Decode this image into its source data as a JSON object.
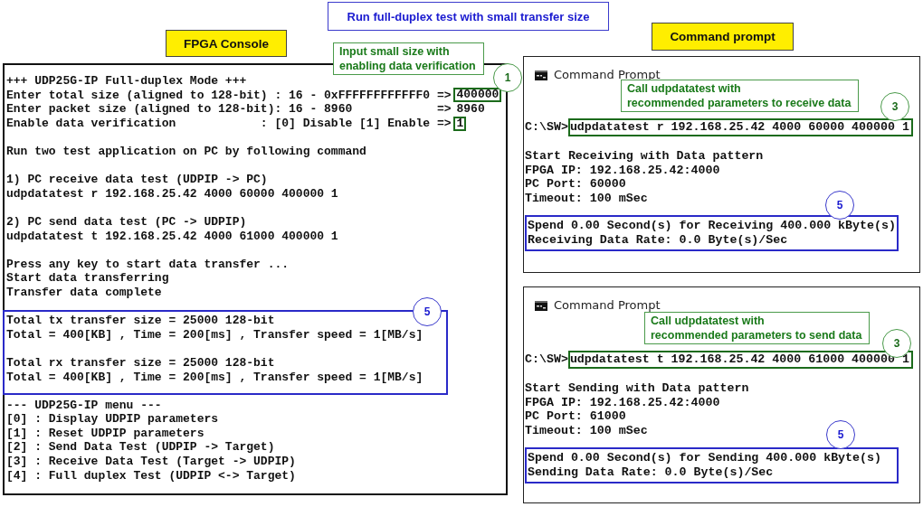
{
  "banner": "Run full-duplex test with small transfer size",
  "fpga_console": {
    "label": "FPGA Console",
    "note": {
      "text": "Input small size with\nenabling data verification",
      "step": "1"
    },
    "sections": [
      {
        "kind": "plain",
        "paragraphs": [
          [
            {
              "text": "+++ UDP25G-IP Full-duplex Mode +++"
            },
            {
              "text": "Enter total size (aligned to 128-bit) : 16 - 0xFFFFFFFFFFFF0 =>",
              "value": "400000",
              "highlighted": true
            },
            {
              "text": "Enter packet size (aligned to 128-bit): 16 - 8960            =>",
              "value": "8960",
              "highlighted": false
            },
            {
              "text": "Enable data verification            : [0] Disable [1] Enable =>",
              "value": "1",
              "highlighted": true
            }
          ]
        ]
      },
      {
        "kind": "plain",
        "paragraphs": [
          [
            {
              "text": "Run two test application on PC by following command"
            }
          ]
        ]
      },
      {
        "kind": "plain",
        "paragraphs": [
          [
            {
              "text": "1) PC receive data test (UDPIP -> PC)"
            },
            {
              "text": "udpdatatest r 192.168.25.42 4000 60000 400000 1"
            }
          ]
        ]
      },
      {
        "kind": "plain",
        "paragraphs": [
          [
            {
              "text": "2) PC send data test (PC -> UDPIP)"
            },
            {
              "text": "udpdatatest t 192.168.25.42 4000 61000 400000 1"
            }
          ]
        ]
      },
      {
        "kind": "plain",
        "paragraphs": [
          [
            {
              "text": "Press any key to start data transfer ..."
            },
            {
              "text": "Start data transferring"
            },
            {
              "text": "Transfer data complete"
            }
          ]
        ]
      },
      {
        "kind": "highlight",
        "step": "5",
        "paragraphs": [
          [
            {
              "text": "Total tx transfer size = 25000 128-bit"
            },
            {
              "text": "Total = 400[KB] , Time = 200[ms] , Transfer speed = 1[MB/s]"
            }
          ],
          [
            {
              "text": "Total rx transfer size = 25000 128-bit"
            },
            {
              "text": "Total = 400[KB] , Time = 200[ms] , Transfer speed = 1[MB/s]"
            }
          ]
        ]
      },
      {
        "kind": "plain",
        "paragraphs": [
          [
            {
              "text": "--- UDP25G-IP menu ---"
            },
            {
              "text": "[0] : Display UDPIP parameters"
            },
            {
              "text": "[1] : Reset UDPIP parameters"
            },
            {
              "text": "[2] : Send Data Test (UDPIP -> Target)"
            },
            {
              "text": "[3] : Receive Data Test (Target -> UDPIP)"
            },
            {
              "text": "[4] : Full duplex Test (UDPIP <-> Target)"
            }
          ]
        ]
      }
    ]
  },
  "command_prompt": {
    "label": "Command prompt",
    "windows": [
      {
        "title": "Command Prompt",
        "note": {
          "text": "Call udpdatatest with\nrecommended parameters to receive data",
          "step": "3"
        },
        "prompt": "C:\\SW>",
        "command": "udpdatatest r 192.168.25.42 4000 60000 400000 1",
        "highlighted": true,
        "info": [
          "Start Receiving with Data pattern",
          "FPGA IP: 192.168.25.42:4000",
          "PC Port: 60000",
          "Timeout: 100 mSec"
        ],
        "result": {
          "step": "5",
          "lines": [
            "Spend 0.00 Second(s) for Receiving 400.000 kByte(s)",
            "Receiving Data Rate: 0.0 Byte(s)/Sec"
          ]
        }
      },
      {
        "title": "Command Prompt",
        "note": {
          "text": "Call udpdatatest with\nrecommended parameters to send data",
          "step": "3"
        },
        "prompt": "C:\\SW>",
        "command": "udpdatatest t 192.168.25.42 4000 61000 400000 1",
        "highlighted": true,
        "info": [
          "Start Sending with Data pattern",
          "FPGA IP: 192.168.25.42:4000",
          "PC Port: 61000",
          "Timeout: 100 mSec"
        ],
        "result": {
          "step": "5",
          "lines": [
            "Spend 0.00 Second(s) for Sending 400.000 kByte(s)",
            "Sending Data Rate: 0.0 Byte(s)/Sec"
          ]
        }
      }
    ]
  }
}
